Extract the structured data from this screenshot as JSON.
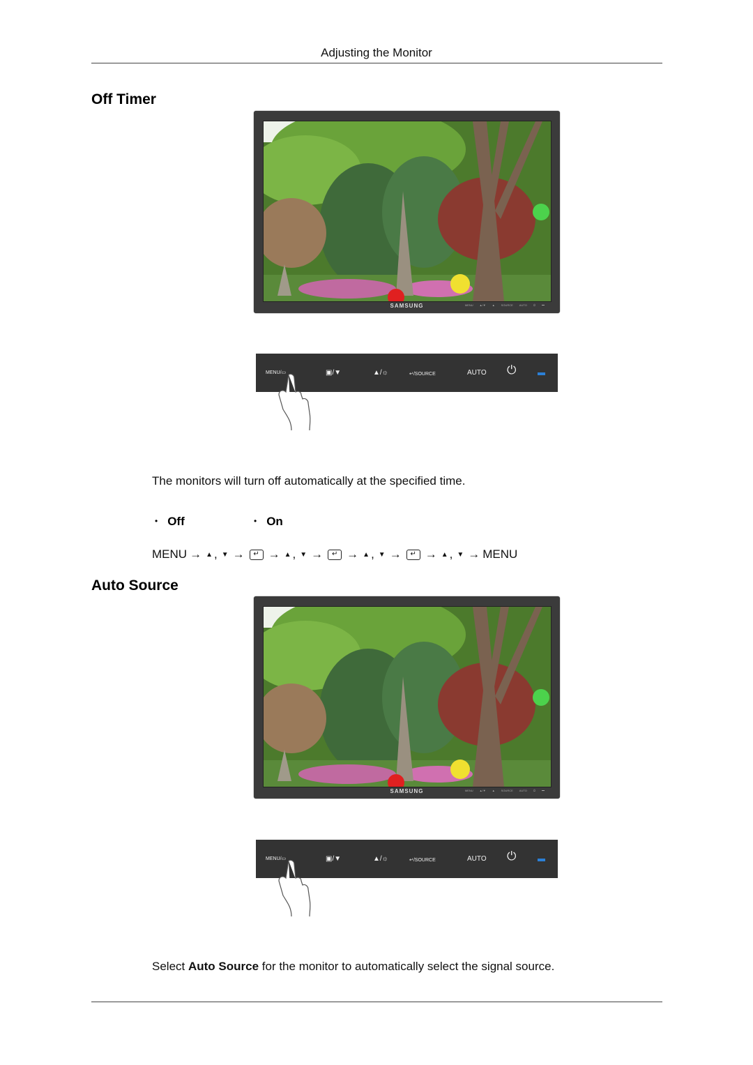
{
  "header": {
    "title": "Adjusting the Monitor"
  },
  "sections": [
    {
      "title": "Off Timer",
      "monitor": {
        "brand": "SAMSUNG",
        "bezel_controls": [
          "MENU",
          "▲/▼",
          "▲",
          "SOURCE",
          "AUTO",
          "power-icon",
          "led"
        ]
      },
      "button_strip": {
        "menu_label": "MENU/▭",
        "down_label": "▣/▼",
        "up_brightness_label": "▲/☼",
        "source_label": "↵/SOURCE",
        "auto_label": "AUTO",
        "power_icon": "power-icon",
        "led_color": "#2b7fd6"
      },
      "description": "The monitors will turn off automatically at the specified time.",
      "options": [
        "Off",
        "On"
      ],
      "sequence": {
        "start": "MENU",
        "arrow": "→",
        "up": "▲",
        "down": "▼",
        "comma": ",",
        "enter": "↵",
        "end": "MENU"
      }
    },
    {
      "title": "Auto Source",
      "monitor": {
        "brand": "SAMSUNG",
        "bezel_controls": [
          "MENU",
          "▲/▼",
          "▲",
          "SOURCE",
          "AUTO",
          "power-icon",
          "led"
        ]
      },
      "button_strip": {
        "menu_label": "MENU/▭",
        "down_label": "▣/▼",
        "up_brightness_label": "▲/☼",
        "source_label": "↵/SOURCE",
        "auto_label": "AUTO",
        "power_icon": "power-icon",
        "led_color": "#2b7fd6"
      },
      "description_prefix": "Select ",
      "description_bold": "Auto Source",
      "description_suffix": " for the monitor to automatically select the signal source."
    }
  ]
}
